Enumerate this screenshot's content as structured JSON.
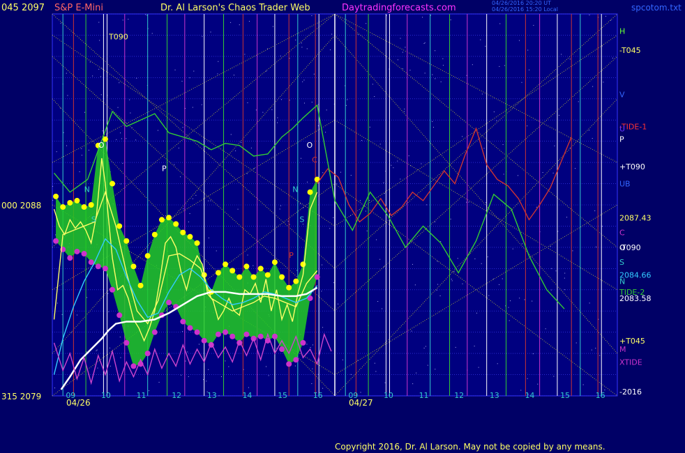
{
  "header": {
    "left_label": "045  2097",
    "instrument": "S&P E-Mini",
    "title": "Dr. Al Larson's Chaos Trader Web",
    "site": "Daytradingforecasts.com",
    "stamp_line1": "04/26/2016 20:20 UT",
    "stamp_line2": "04/26/2016 15:20 Local",
    "file": "spcotom.txt"
  },
  "copyright": "Copyright 2016, Dr. Al Larson. May not be copied by any means.",
  "colors": {
    "background": "#000066",
    "plot_bg": "#000080",
    "grid": "#4444ff",
    "price_band": "#22cc22",
    "highs": "#ffff00",
    "lows": "#cc33cc",
    "fast_ma": "#ffff66",
    "mid_ma": "#33ccff",
    "slow_ma": "#ffffff",
    "xtide": "#cc44cc",
    "tide": "#cc3333",
    "flux_green": "#33cc33"
  },
  "chart_data": {
    "type": "line",
    "title": "S&P E-Mini",
    "ylim": [
      2079,
      2097
    ],
    "y_ticks": [
      {
        "value": 2097,
        "label": "045  2097"
      },
      {
        "value": 2088,
        "label": "000  2088"
      },
      {
        "value": 2079,
        "label": "315  2079"
      }
    ],
    "x_range": [
      8.5,
      16.5
    ],
    "x_labels": [
      "09",
      "10",
      "11",
      "12",
      "13",
      "14",
      "15",
      "16",
      "09",
      "10",
      "11",
      "12",
      "13",
      "14",
      "15",
      "16"
    ],
    "date_labels": [
      "04/26",
      "04/27"
    ],
    "right_labels": [
      {
        "text": "H",
        "value": 2096.2,
        "color": "#66ff33"
      },
      {
        "text": "-T045",
        "value": 2095.3,
        "color": "#ffff66"
      },
      {
        "text": "V",
        "value": 2093.2,
        "color": "#3366ff"
      },
      {
        "text": "-TIDE-1",
        "value": 2091.7,
        "color": "#ff3333"
      },
      {
        "text": "U",
        "value": 2091.6,
        "color": "#6633ff"
      },
      {
        "text": "P",
        "value": 2091.1,
        "color": "#ffffff"
      },
      {
        "text": "+T090",
        "value": 2089.8,
        "color": "#ffffff"
      },
      {
        "text": "UB",
        "value": 2089.0,
        "color": "#3366ff"
      },
      {
        "text": "2087.43",
        "value": 2087.4,
        "color": "#ffff66"
      },
      {
        "text": "C",
        "value": 2086.7,
        "color": "#cc33cc"
      },
      {
        "text": "-T090",
        "value": 2086.0,
        "color": "#ffffff"
      },
      {
        "text": "O",
        "value": 2086.0,
        "color": "#ffffff"
      },
      {
        "text": "S",
        "value": 2085.3,
        "color": "#33cccc"
      },
      {
        "text": "2084.66",
        "value": 2084.7,
        "color": "#33ccff"
      },
      {
        "text": "N",
        "value": 2084.4,
        "color": "#33cccc"
      },
      {
        "text": "TIDE-2",
        "value": 2083.9,
        "color": "#33cc33"
      },
      {
        "text": "2083.58",
        "value": 2083.6,
        "color": "#ffffff"
      },
      {
        "text": "+T045",
        "value": 2081.6,
        "color": "#ffff66"
      },
      {
        "text": "M",
        "value": 2081.2,
        "color": "#cc33cc"
      },
      {
        "text": "XTIDE",
        "value": 2080.6,
        "color": "#cc33cc"
      },
      {
        "text": "-2016",
        "value": 2079.2,
        "color": "#ffffff"
      }
    ],
    "series": [
      {
        "name": "price",
        "color": "#ffff66",
        "x": [
          8.55,
          8.7,
          8.85,
          9.0,
          9.15,
          9.3,
          9.45,
          9.6,
          9.75,
          9.9,
          10.0,
          10.1,
          10.2,
          10.35,
          10.5,
          10.65,
          10.8,
          10.95,
          11.1,
          11.25,
          11.4,
          11.55,
          11.7,
          11.85,
          12.0,
          12.15,
          12.3,
          12.45,
          12.6,
          12.75,
          12.9,
          13.05,
          13.2,
          13.35,
          13.5,
          13.65,
          13.8,
          13.95,
          14.1,
          14.25,
          14.4,
          14.55,
          14.7,
          14.85,
          15.0,
          15.15,
          15.3,
          15.45,
          15.6,
          15.8,
          16.0
        ],
        "y": [
          2087.8,
          2087.0,
          2086.6,
          2087.3,
          2086.9,
          2087.2,
          2086.8,
          2086.2,
          2087.5,
          2090.2,
          2089.0,
          2087.2,
          2085.5,
          2084.0,
          2084.2,
          2083.6,
          2082.6,
          2082.2,
          2081.6,
          2082.2,
          2083.0,
          2084.5,
          2086.2,
          2086.5,
          2086.0,
          2084.8,
          2084.0,
          2085.0,
          2085.6,
          2085.2,
          2083.8,
          2083.5,
          2082.6,
          2083.0,
          2083.6,
          2083.0,
          2082.8,
          2084.0,
          2083.8,
          2084.3,
          2083.4,
          2084.5,
          2083.0,
          2084.0,
          2082.6,
          2083.3,
          2082.5,
          2083.8,
          2084.7,
          2087.8,
          2088.6
        ]
      },
      {
        "name": "ma-fast",
        "color": "#ffff66",
        "x": [
          8.55,
          8.8,
          9.1,
          9.4,
          9.7,
          10.0,
          10.3,
          10.6,
          10.9,
          11.2,
          11.5,
          11.8,
          12.1,
          12.4,
          12.7,
          13.0,
          13.3,
          13.6,
          13.9,
          14.2,
          14.5,
          14.8,
          15.1,
          15.4,
          15.7,
          16.0
        ],
        "y": [
          2082.6,
          2086.6,
          2086.8,
          2087.0,
          2087.2,
          2088.6,
          2087.0,
          2084.8,
          2083.0,
          2082.4,
          2083.5,
          2085.6,
          2085.7,
          2085.4,
          2085.0,
          2083.6,
          2083.3,
          2083.0,
          2083.2,
          2083.4,
          2083.7,
          2083.6,
          2083.4,
          2083.2,
          2084.3,
          2084.9
        ]
      },
      {
        "name": "ma-mid",
        "color": "#33ccff",
        "x": [
          8.55,
          8.8,
          9.1,
          9.4,
          9.7,
          10.0,
          10.3,
          10.6,
          10.9,
          11.2,
          11.5,
          11.8,
          12.1,
          12.4,
          12.7,
          13.0,
          13.3,
          13.6,
          13.9,
          14.2,
          14.5,
          14.8,
          15.1,
          15.4,
          15.7,
          16.0
        ],
        "y": [
          2080.0,
          2081.7,
          2083.2,
          2084.4,
          2085.3,
          2086.4,
          2085.9,
          2084.6,
          2083.5,
          2082.7,
          2082.9,
          2083.9,
          2084.7,
          2085.0,
          2084.6,
          2084.0,
          2083.6,
          2083.3,
          2083.4,
          2083.6,
          2083.9,
          2083.8,
          2083.6,
          2083.4,
          2083.6,
          2084.2
        ]
      },
      {
        "name": "ma-slow",
        "color": "#ffffff",
        "x": [
          8.75,
          9.0,
          9.3,
          9.6,
          9.9,
          10.1,
          10.3,
          10.6,
          11.0,
          11.4,
          11.8,
          12.2,
          12.6,
          13.0,
          13.4,
          13.8,
          14.2,
          14.6,
          15.0,
          15.4,
          15.7,
          16.0
        ],
        "y": [
          2079.3,
          2079.9,
          2080.7,
          2081.2,
          2081.7,
          2082.1,
          2082.4,
          2082.5,
          2082.5,
          2082.6,
          2082.9,
          2083.3,
          2083.7,
          2083.9,
          2083.9,
          2083.8,
          2083.8,
          2083.8,
          2083.7,
          2083.7,
          2083.8,
          2084.1
        ]
      },
      {
        "name": "xtide",
        "color": "#cc44cc",
        "x": [
          8.55,
          8.8,
          9.0,
          9.2,
          9.4,
          9.6,
          9.8,
          10.0,
          10.2,
          10.4,
          10.6,
          10.8,
          11.0,
          11.2,
          11.4,
          11.6,
          11.8,
          12.0,
          12.2,
          12.4,
          12.6,
          12.8,
          13.0,
          13.2,
          13.4,
          13.6,
          13.8,
          14.0,
          14.2,
          14.4,
          14.6,
          14.8,
          15.0,
          15.2,
          15.4,
          15.6,
          15.8,
          16.0,
          16.2,
          16.4
        ],
        "y": [
          2081.5,
          2080.2,
          2081.0,
          2079.8,
          2080.8,
          2079.6,
          2080.9,
          2080.0,
          2081.1,
          2079.7,
          2080.6,
          2079.9,
          2080.7,
          2080.0,
          2081.2,
          2080.3,
          2081.0,
          2080.4,
          2081.4,
          2080.5,
          2081.2,
          2080.6,
          2081.5,
          2080.8,
          2081.3,
          2080.6,
          2081.6,
          2080.9,
          2081.7,
          2080.7,
          2081.9,
          2081.0,
          2081.6,
          2081.0,
          2081.8,
          2080.8,
          2081.2,
          2080.5,
          2081.9,
          2081.1
        ]
      },
      {
        "name": "tide",
        "color": "#cc3333",
        "x": [
          16.0,
          16.3,
          16.6,
          16.9,
          17.2,
          17.5,
          17.8,
          18.1,
          18.4,
          18.7,
          19.0,
          19.3,
          19.6,
          19.9,
          20.2,
          20.5,
          20.8,
          21.1,
          21.4,
          21.7,
          22.0,
          22.3,
          22.6,
          22.9,
          23.2
        ],
        "y": [
          2089.0,
          2089.7,
          2089.3,
          2088.0,
          2087.2,
          2087.6,
          2088.3,
          2087.5,
          2087.9,
          2088.6,
          2088.2,
          2088.9,
          2089.6,
          2089.0,
          2090.4,
          2091.6,
          2089.9,
          2089.2,
          2088.9,
          2088.3,
          2087.3,
          2088.0,
          2088.8,
          2090.0,
          2091.2
        ]
      },
      {
        "name": "flux",
        "color": "#33cc33",
        "x": [
          8.55,
          9.0,
          9.5,
          10.0,
          10.2,
          10.6,
          11.0,
          11.4,
          11.8,
          12.2,
          12.6,
          13.0,
          13.4,
          13.8,
          14.2,
          14.6,
          15.0,
          15.3,
          15.6,
          16.0,
          16.5,
          17.0,
          17.5,
          18.0,
          18.5,
          19.0,
          19.5,
          20.0,
          20.5,
          21.0,
          21.5,
          22.0,
          22.5,
          23.0
        ],
        "y": [
          2089.5,
          2088.6,
          2089.2,
          2091.5,
          2092.4,
          2091.7,
          2092.0,
          2092.3,
          2091.4,
          2091.2,
          2091.0,
          2090.6,
          2090.9,
          2090.8,
          2090.3,
          2090.4,
          2091.2,
          2091.6,
          2092.1,
          2092.7,
          2088.2,
          2086.8,
          2088.6,
          2087.5,
          2086.0,
          2087.0,
          2086.2,
          2084.8,
          2086.3,
          2088.5,
          2087.8,
          2085.6,
          2084.0,
          2083.1
        ]
      }
    ],
    "band": {
      "x": [
        8.6,
        8.8,
        9.0,
        9.2,
        9.4,
        9.6,
        9.8,
        10.0,
        10.2,
        10.4,
        10.6,
        10.8,
        11.0,
        11.2,
        11.4,
        11.6,
        11.8,
        12.0,
        12.2,
        12.4,
        12.6,
        12.8,
        13.0,
        13.2,
        13.4,
        13.6,
        13.8,
        14.0,
        14.2,
        14.4,
        14.6,
        14.8,
        15.0,
        15.2,
        15.4,
        15.6,
        15.8,
        16.0
      ],
      "high": [
        2088.4,
        2087.9,
        2088.1,
        2088.2,
        2087.9,
        2088.0,
        2090.8,
        2091.1,
        2089.0,
        2087.0,
        2086.3,
        2085.1,
        2084.2,
        2085.6,
        2086.6,
        2087.3,
        2087.4,
        2087.1,
        2086.7,
        2086.5,
        2086.2,
        2084.7,
        2083.9,
        2084.8,
        2085.2,
        2084.9,
        2084.6,
        2085.1,
        2084.6,
        2085.0,
        2084.7,
        2085.3,
        2084.6,
        2084.1,
        2084.4,
        2085.2,
        2088.6,
        2089.2
      ],
      "low": [
        2086.3,
        2085.9,
        2085.5,
        2085.8,
        2085.7,
        2085.3,
        2085.1,
        2085.0,
        2084.0,
        2082.8,
        2081.5,
        2080.4,
        2080.5,
        2081.0,
        2082.0,
        2082.8,
        2083.4,
        2083.2,
        2082.5,
        2082.2,
        2082.0,
        2081.6,
        2081.4,
        2081.9,
        2082.0,
        2081.8,
        2081.5,
        2081.9,
        2081.7,
        2081.8,
        2081.6,
        2081.8,
        2081.2,
        2080.5,
        2080.7,
        2081.5,
        2083.6,
        2084.6
      ]
    },
    "time_lines": [
      {
        "x": 8.8,
        "color": "#33cccc"
      },
      {
        "x": 9.1,
        "color": "#cc3333"
      },
      {
        "x": 9.45,
        "color": "#33cc33"
      },
      {
        "x": 9.95,
        "color": "#ffffff"
      },
      {
        "x": 10.05,
        "color": "#ffffff"
      },
      {
        "x": 10.55,
        "color": "#cc33cc"
      },
      {
        "x": 11.2,
        "color": "#33cccc"
      },
      {
        "x": 11.75,
        "color": "#33cc33"
      },
      {
        "x": 12.25,
        "color": "#cc33cc"
      },
      {
        "x": 12.8,
        "color": "#ffffff"
      },
      {
        "x": 13.35,
        "color": "#33cc33"
      },
      {
        "x": 13.9,
        "color": "#cc3333"
      },
      {
        "x": 14.3,
        "color": "#cc33cc"
      },
      {
        "x": 14.8,
        "color": "#ffffff"
      },
      {
        "x": 15.2,
        "color": "#cc3333"
      },
      {
        "x": 15.45,
        "color": "#33cccc"
      },
      {
        "x": 15.95,
        "color": "#cc3333"
      },
      {
        "x": 16.05,
        "color": "#ffffff"
      }
    ],
    "markers": [
      {
        "text": "T090",
        "x": 10.1,
        "y": 2095.8,
        "color": "#ffff66"
      },
      {
        "text": "O",
        "x": 9.8,
        "y": 2090.7,
        "color": "#ffffff"
      },
      {
        "text": "N",
        "x": 9.4,
        "y": 2088.6,
        "color": "#33cccc"
      },
      {
        "text": "S",
        "x": 9.6,
        "y": 2087.2,
        "color": "#33cccc"
      },
      {
        "text": "P",
        "x": 11.6,
        "y": 2089.6,
        "color": "#ffffff"
      },
      {
        "text": "O",
        "x": 15.7,
        "y": 2090.7,
        "color": "#ffffff"
      },
      {
        "text": "N",
        "x": 15.3,
        "y": 2088.6,
        "color": "#33cccc"
      },
      {
        "text": "S",
        "x": 15.5,
        "y": 2087.2,
        "color": "#33cccc"
      },
      {
        "text": "C",
        "x": 15.85,
        "y": 2090.0,
        "color": "#cc3333"
      },
      {
        "text": "P",
        "x": 15.2,
        "y": 2085.5,
        "color": "#cc3333"
      }
    ]
  }
}
